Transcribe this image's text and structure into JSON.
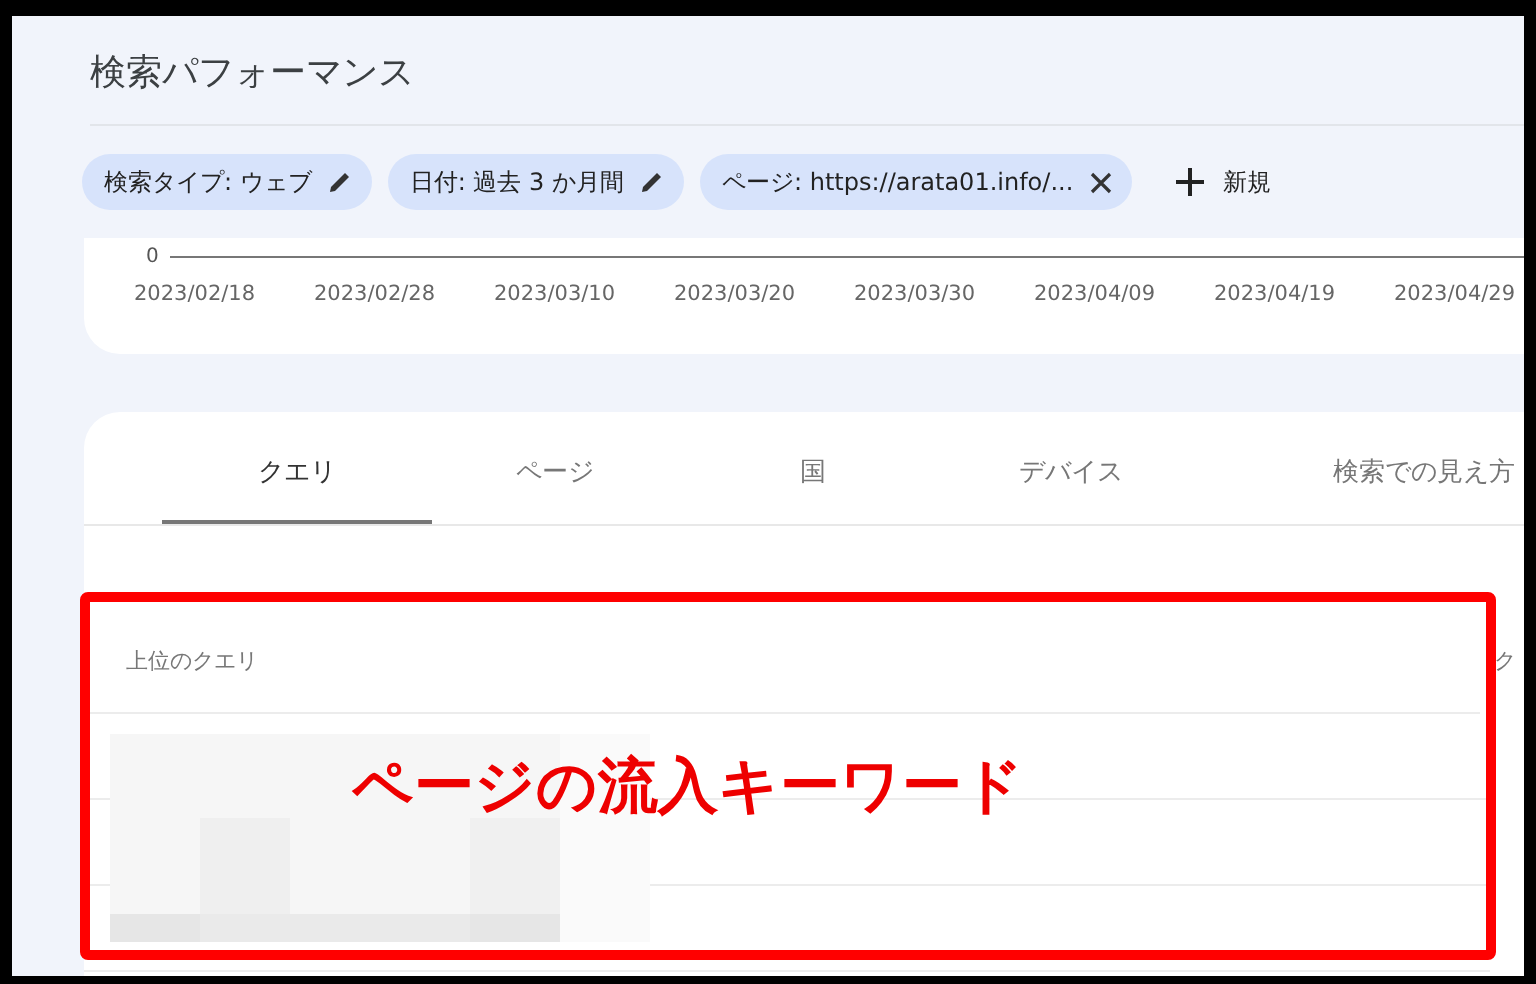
{
  "header": {
    "title": "検索パフォーマンス"
  },
  "filters": [
    {
      "label": "検索タイプ: ウェブ",
      "kind": "edit"
    },
    {
      "label": "日付: 過去 3 か月間",
      "kind": "edit"
    },
    {
      "label": "ページ: https://arata01.info/...",
      "kind": "remove"
    }
  ],
  "new_filter": {
    "label": "新規"
  },
  "chart": {
    "y_label": "0",
    "x_labels": [
      "2023/02/18",
      "2023/02/28",
      "2023/03/10",
      "2023/03/20",
      "2023/03/30",
      "2023/04/09",
      "2023/04/19",
      "2023/04/29"
    ]
  },
  "tabs": [
    {
      "label": "クエリ",
      "selected": true
    },
    {
      "label": "ページ",
      "selected": false
    },
    {
      "label": "国",
      "selected": false
    },
    {
      "label": "デバイス",
      "selected": false
    },
    {
      "label": "検索での見え方",
      "selected": false
    }
  ],
  "table": {
    "columns": [
      "上位のクエリ",
      "ク"
    ]
  },
  "annotation": {
    "label": "ページの流入キーワード"
  }
}
